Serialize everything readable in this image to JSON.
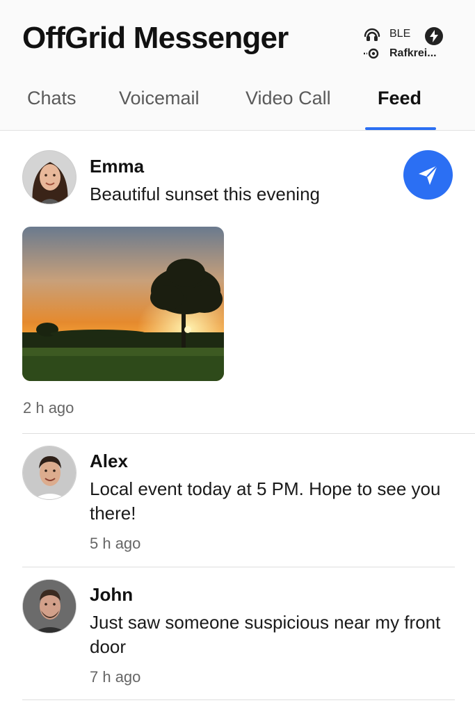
{
  "app": {
    "title": "OffGrid Messenger"
  },
  "status": {
    "connection": "BLE",
    "network": "Rafkrei..."
  },
  "tabs": [
    {
      "label": "Chats"
    },
    {
      "label": "Voicemail"
    },
    {
      "label": "Video Call"
    },
    {
      "label": "Feed",
      "active": true
    }
  ],
  "feed": [
    {
      "author": "Emma",
      "text": "Beautiful sunset this evening",
      "time": "2 h ago",
      "has_image": true,
      "image": "sunset-with-tree-photo"
    },
    {
      "author": "Alex",
      "text": "Local event today at 5 PM. Hope to see you there!",
      "time": "5 h ago"
    },
    {
      "author": "John",
      "text": "Just saw someone suspicious near my front door",
      "time": "7 h ago"
    }
  ],
  "colors": {
    "accent": "#2b6ff3",
    "text": "#111111",
    "muted": "#666666",
    "header_bg": "#fafafa"
  },
  "icons": {
    "send": "send-icon",
    "bluetooth": "bluetooth-icon",
    "wifi": "network-icon",
    "power": "bolt-icon"
  }
}
